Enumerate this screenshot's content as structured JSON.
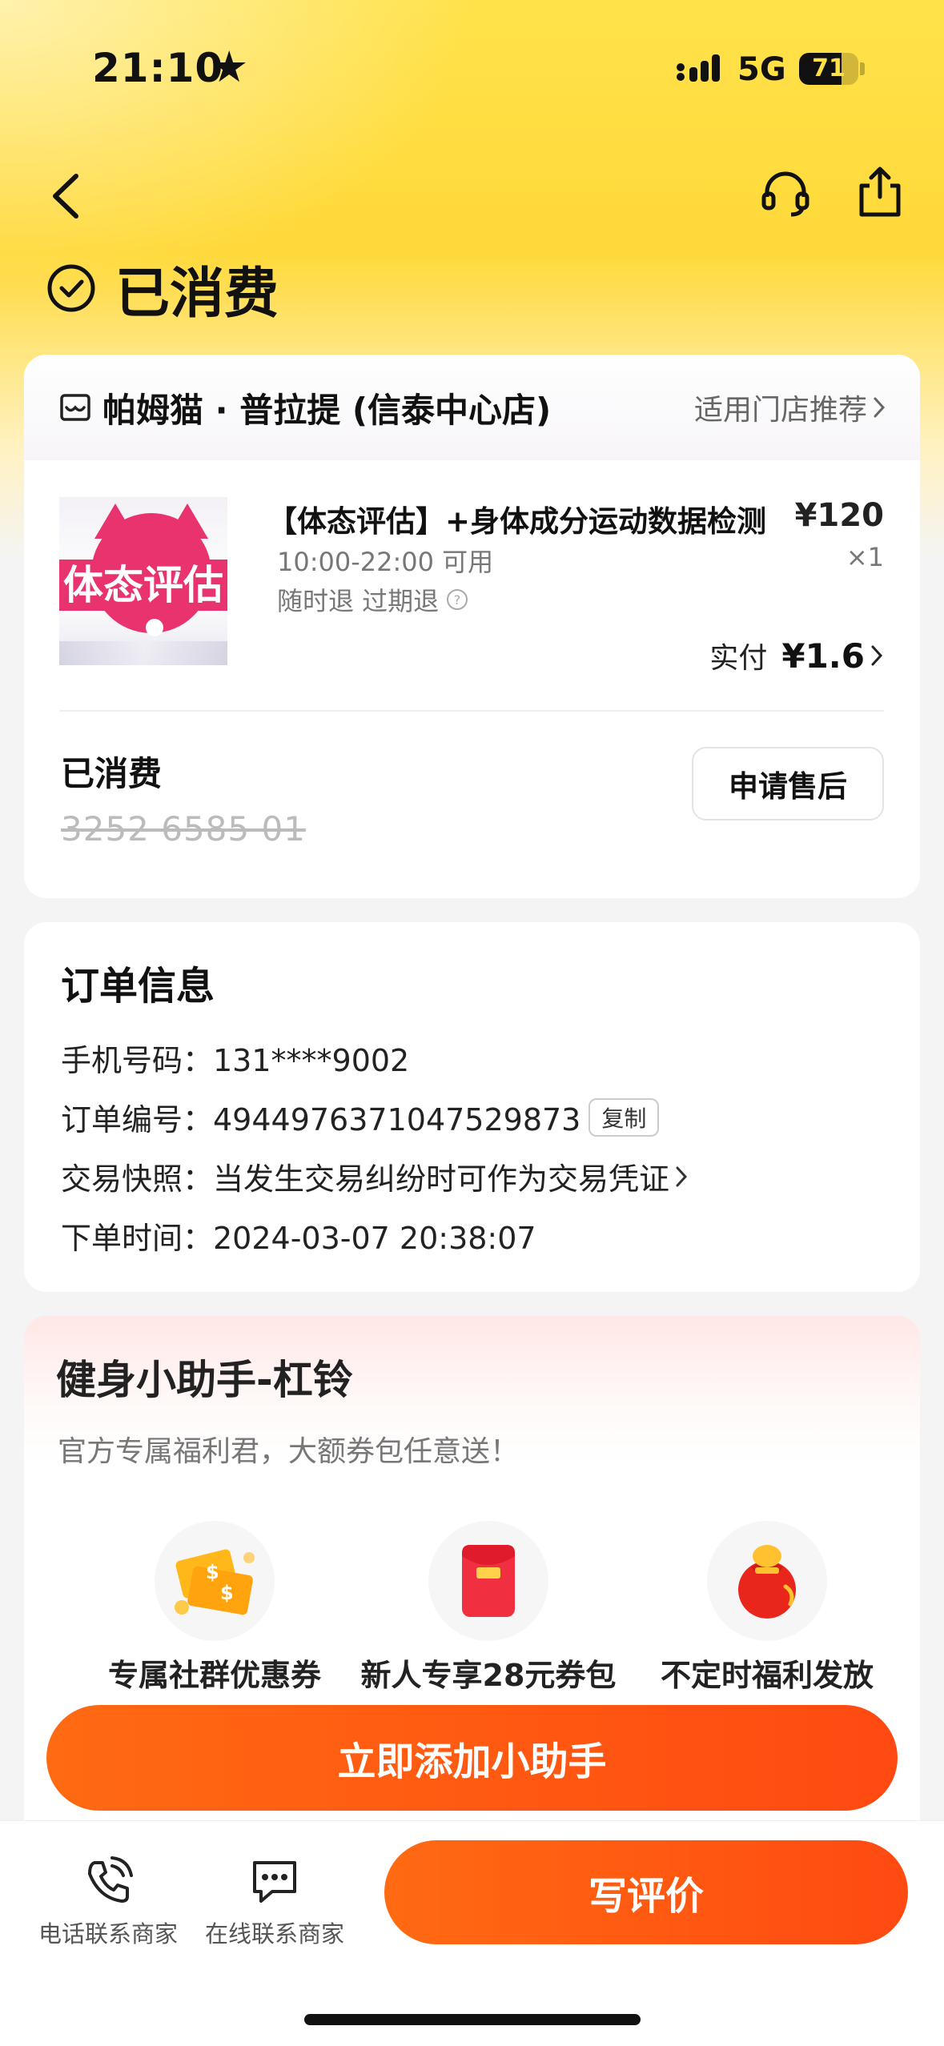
{
  "status_bar": {
    "time": "21:10",
    "network": "5G",
    "battery": "71",
    "battery_level": 0.71
  },
  "header": {
    "status_title": "已消费"
  },
  "order": {
    "store_name": "帕姆猫 · 普拉提 (信泰中心店)",
    "store_link": "适用门店推荐",
    "product": {
      "thumb_text": "体态评估",
      "title": "【体态评估】+身体成分运动数据检测",
      "price": "¥120",
      "hours": "10:00-22:00 可用",
      "quantity": "×1",
      "refund": "随时退 过期退",
      "paid_label": "实付",
      "paid_value": "¥1.6"
    },
    "consumed_label": "已消费",
    "code": "3252 6585 01",
    "aftersale_button": "申请售后"
  },
  "order_info": {
    "title": "订单信息",
    "phone": "手机号码：131****9002",
    "order_no": "订单编号：4944976371047529873",
    "copy_button": "复制",
    "snapshot": "交易快照：当发生交易纠纷时可作为交易凭证",
    "order_time": "下单时间：2024-03-07 20:38:07"
  },
  "assistant": {
    "title": "健身小助手-杠铃",
    "subtitle": "官方专属福利君，大额券包任意送！",
    "perks": [
      {
        "label": "专属社群优惠券",
        "icon": "coupon-icon"
      },
      {
        "label": "新人专享28元券包",
        "icon": "red-packet-icon"
      },
      {
        "label": "不定时福利发放",
        "icon": "gift-bag-icon"
      }
    ],
    "add_button": "立即添加小助手"
  },
  "bottom_bar": {
    "phone_contact": "电话联系商家",
    "online_contact": "在线联系商家",
    "review_button": "写评价"
  },
  "colors": {
    "accent": "#ff5a12",
    "header_yellow": "#ffd93a",
    "thumb_pink": "#e8336e"
  }
}
